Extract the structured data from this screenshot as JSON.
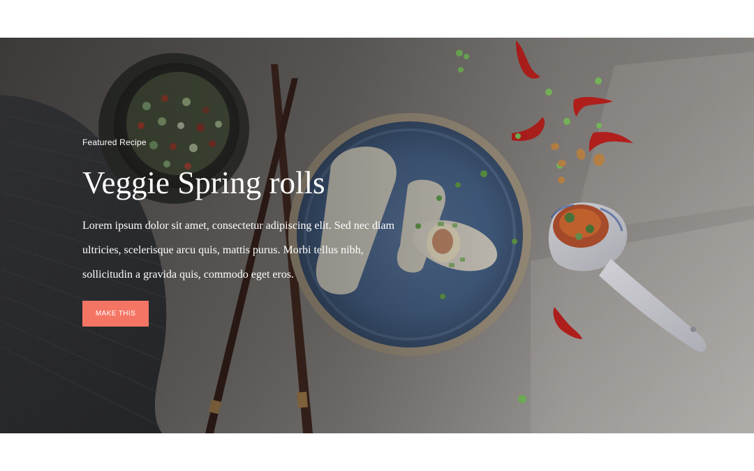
{
  "hero": {
    "eyebrow": "Featured Recipe",
    "title": "Veggie Spring rolls",
    "description": "Lorem ipsum dolor sit amet, consectetur adipiscing elit. Sed nec diam ultricies, scelerisque arcu quis, mattis purus. Morbi tellus nibh, sollicitudin a gravida quis, commodo eget eros.",
    "button_label": "MAKE THIS",
    "button_color": "#f57565"
  },
  "icons": [
    "hero-food-photo"
  ]
}
